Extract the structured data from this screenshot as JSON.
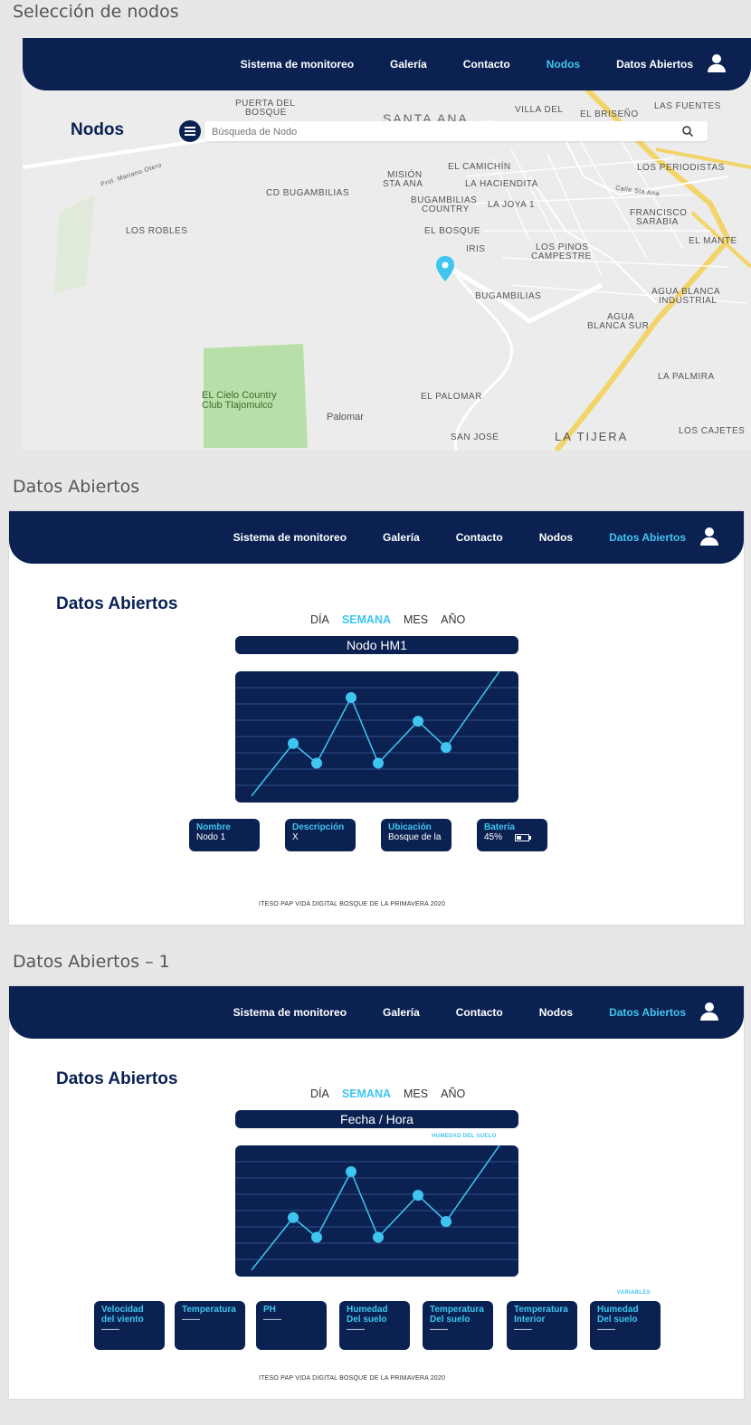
{
  "sections": [
    {
      "title": "Selección de nodos"
    },
    {
      "title": "Datos Abiertos"
    },
    {
      "title": "Datos Abiertos – 1"
    }
  ],
  "nav": {
    "items": [
      "Sistema de monitoreo",
      "Galería",
      "Contacto",
      "Nodos",
      "Datos Abiertos"
    ]
  },
  "nodos_page": {
    "title": "Nodos",
    "search_placeholder": "Búsqueda de Nodo",
    "map_labels": [
      {
        "text": "PUERTA DEL"
      },
      {
        "text": "BOSQUE"
      },
      {
        "text": "SANTA ANA"
      },
      {
        "text": "VILLA DEL"
      },
      {
        "text": "EL BRISEÑO"
      },
      {
        "text": "LAS FUENTES"
      },
      {
        "text": "EL CAMICHÍN"
      },
      {
        "text": "LA HACIENDITA"
      },
      {
        "text": "MISIÓN"
      },
      {
        "text": "STA ANA"
      },
      {
        "text": "CD BUGAMBILIAS"
      },
      {
        "text": "BUGAMBILIAS"
      },
      {
        "text": "COUNTRY"
      },
      {
        "text": "LA JOYA 1"
      },
      {
        "text": "LOS PERIODISTAS"
      },
      {
        "text": "LOS ROBLES"
      },
      {
        "text": "EL BOSQUE"
      },
      {
        "text": "IRIS"
      },
      {
        "text": "LOS PINOS"
      },
      {
        "text": "CAMPESTRE"
      },
      {
        "text": "FRANCISCO"
      },
      {
        "text": "SARABIA"
      },
      {
        "text": "EL MANTE"
      },
      {
        "text": "BUGAMBILIAS"
      },
      {
        "text": "AGUA BLANCA"
      },
      {
        "text": "INDUSTRIAL"
      },
      {
        "text": "AGUA"
      },
      {
        "text": "BLANCA SUR"
      },
      {
        "text": "EL Cielo Country"
      },
      {
        "text": "Club Tlajomulco"
      },
      {
        "text": "LA PALMIRA"
      },
      {
        "text": "EL PALOMAR"
      },
      {
        "text": "Palomar"
      },
      {
        "text": "SAN JOSÉ"
      },
      {
        "text": "LA TIJERA"
      },
      {
        "text": "LOS CAJETES"
      },
      {
        "text": "Prol. Mariano Otero"
      },
      {
        "text": "Calle Sta Ana"
      }
    ]
  },
  "datos": {
    "title": "Datos Abiertos",
    "tabs": [
      "DÍA",
      "SEMANA",
      "MES",
      "AÑO"
    ],
    "active_tab": "SEMANA",
    "node_pill": "Nodo HM1",
    "cards": [
      {
        "label": "Nombre",
        "value": "Nodo 1"
      },
      {
        "label": "Descripción",
        "value": "X"
      },
      {
        "label": "Ubicación",
        "value": "Bosque de la"
      },
      {
        "label": "Batería",
        "value": "45%",
        "battery_level": 0.45
      }
    ],
    "footer": "ITESO PAP VIDA DIGITAL BOSQUE DE LA PRIMAVERA 2020"
  },
  "datos1": {
    "title": "Datos Abiertos",
    "tabs": [
      "DÍA",
      "SEMANA",
      "MES",
      "AÑO"
    ],
    "active_tab": "SEMANA",
    "pill": "Fecha / Hora",
    "chart_label": "HUMEDAD DEL SUELO",
    "variables_label": "VARIABLES",
    "cards": [
      {
        "label": "Velocidad del viento",
        "value": "——"
      },
      {
        "label": "Temperatura",
        "value": "——"
      },
      {
        "label": "PH",
        "value": "——"
      },
      {
        "label": "Humedad Del suelo",
        "value": "——"
      },
      {
        "label": "Temperatura Del suelo",
        "value": "——"
      },
      {
        "label": "Temperatura Interior",
        "value": "——"
      },
      {
        "label": "Humedad Del suelo",
        "value": "——"
      }
    ],
    "footer": "ITESO PAP VIDA DIGITAL BOSQUE DE LA PRIMAVERA 2020"
  },
  "colors": {
    "navy": "#0a2152",
    "accent": "#3ec6f0",
    "map_bg": "#ececec",
    "park": "#b9dfa8",
    "highway": "#f3d46a"
  },
  "chart_data": [
    {
      "type": "line",
      "values": [
        5,
        45,
        30,
        80,
        30,
        62,
        42,
        100
      ]
    },
    {
      "type": "line",
      "values": [
        5,
        45,
        30,
        80,
        30,
        62,
        42,
        100
      ]
    }
  ]
}
